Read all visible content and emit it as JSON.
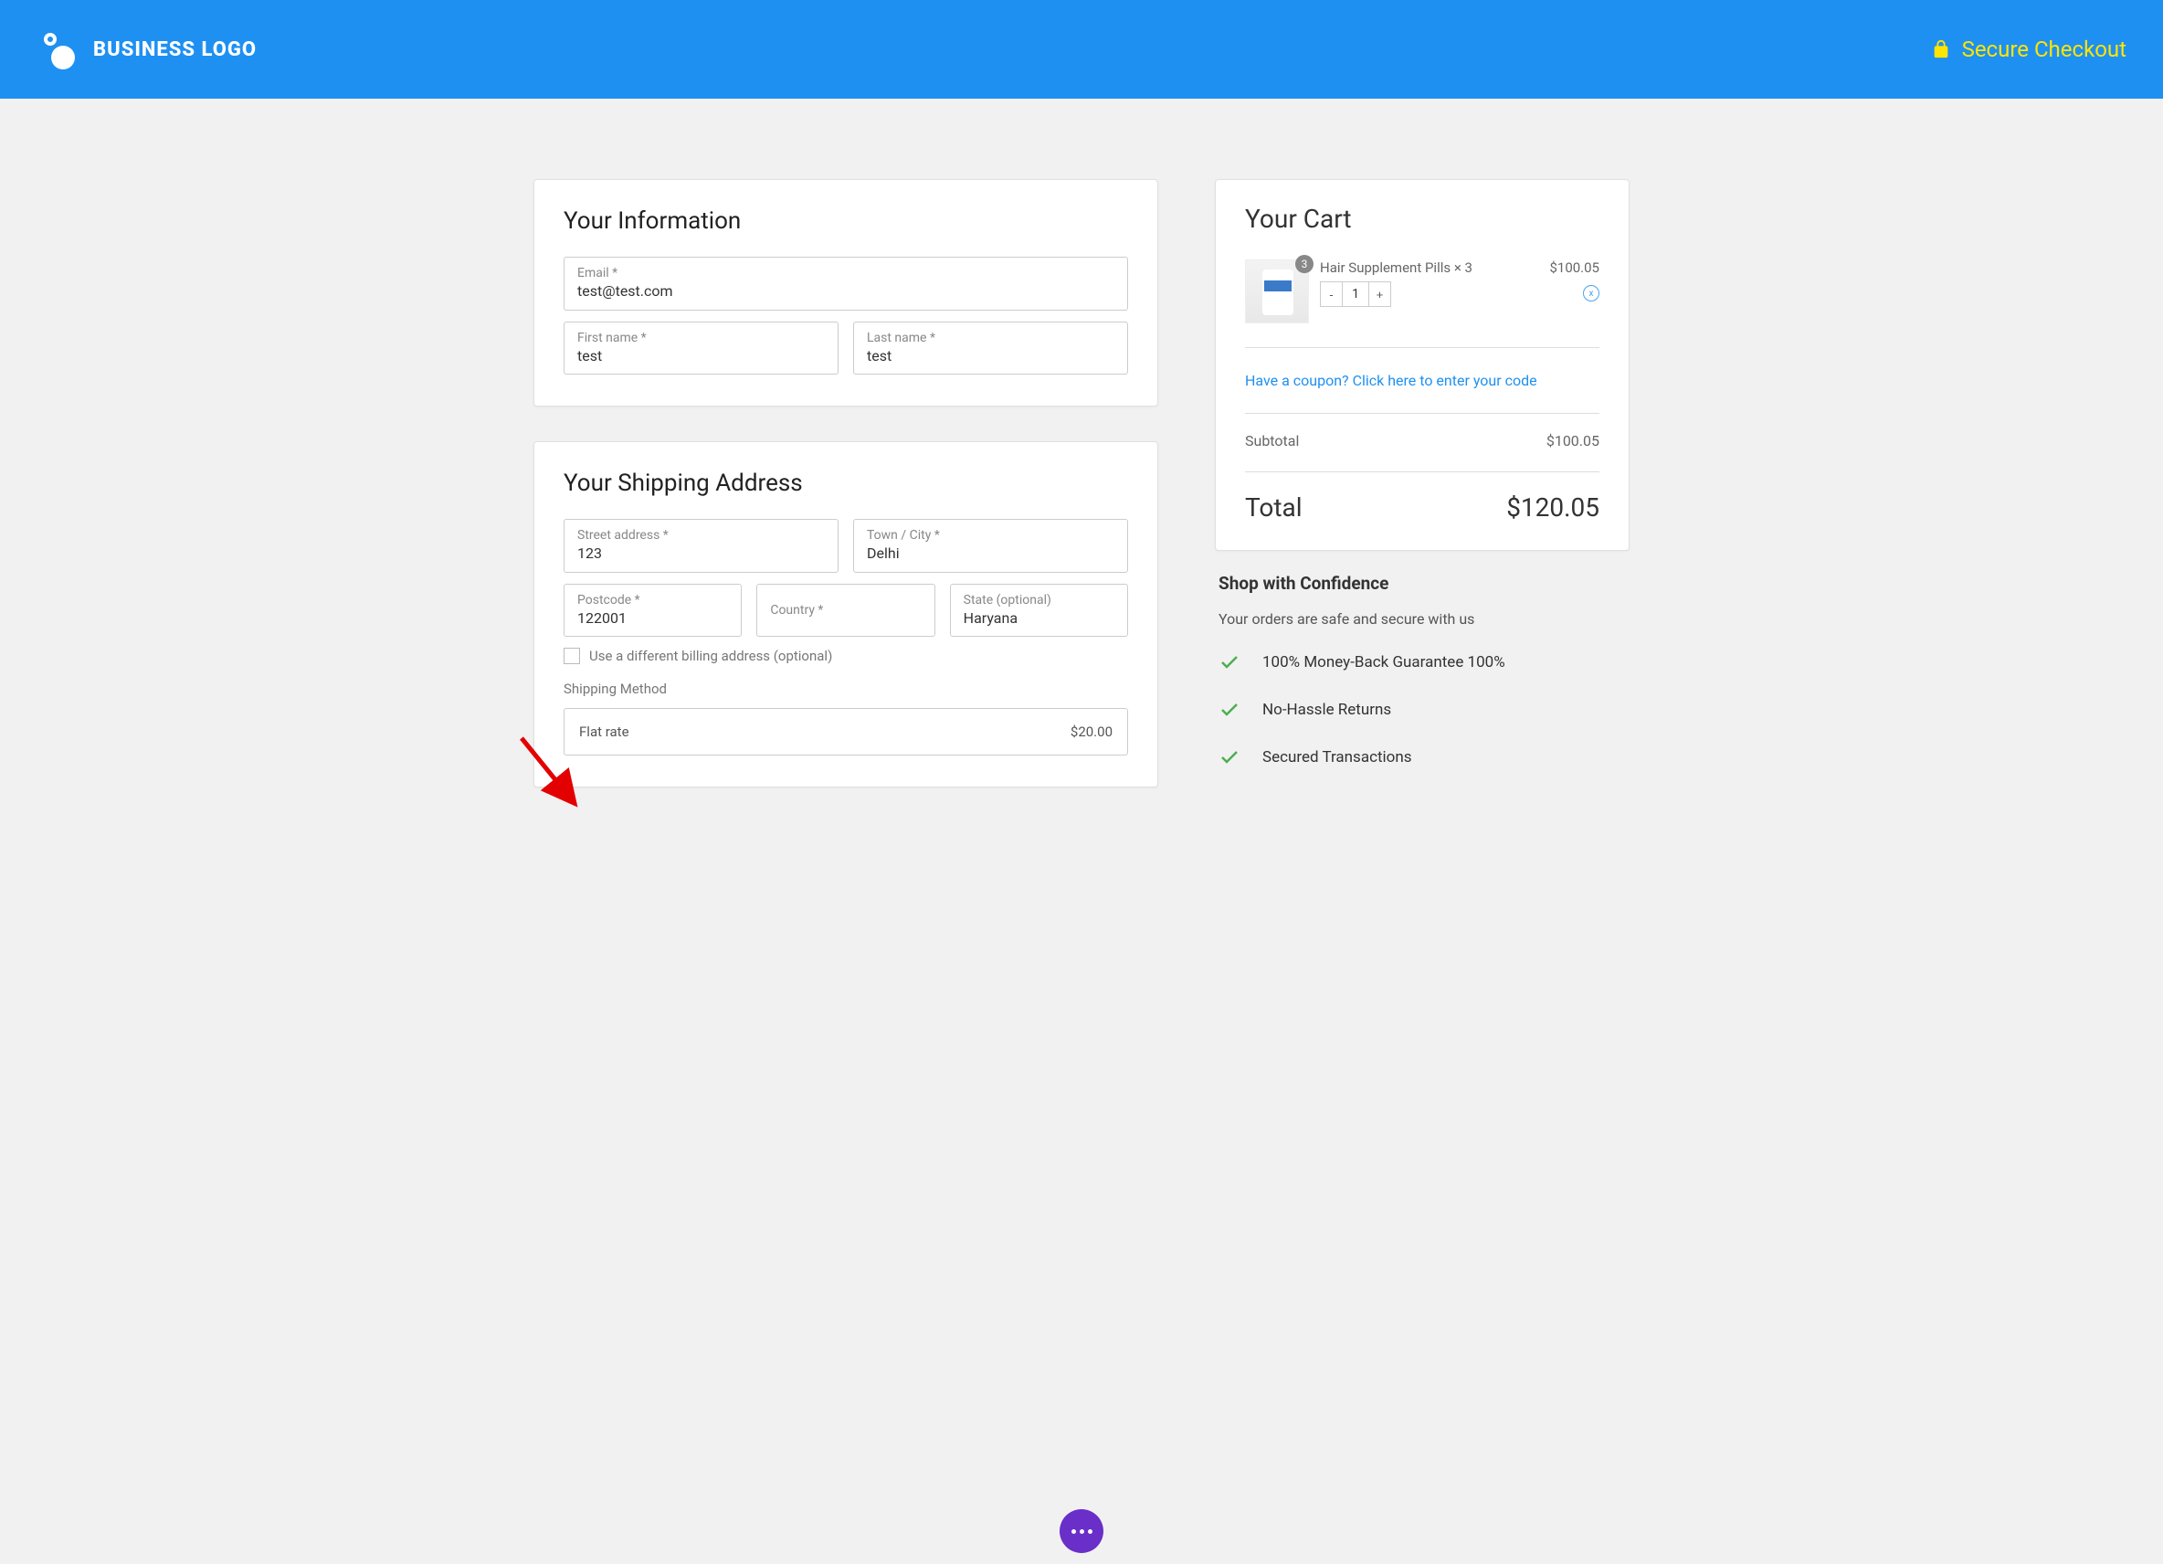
{
  "header": {
    "logo_text": "BUSINESS LOGO",
    "secure_text": "Secure Checkout"
  },
  "info": {
    "heading": "Your Information",
    "email_label": "Email *",
    "email_value": "test@test.com",
    "firstname_label": "First name *",
    "firstname_value": "test",
    "lastname_label": "Last name *",
    "lastname_value": "test"
  },
  "shipping": {
    "heading": "Your Shipping Address",
    "street_label": "Street address *",
    "street_value": "123",
    "city_label": "Town / City *",
    "city_value": "Delhi",
    "postcode_label": "Postcode *",
    "postcode_value": "122001",
    "country_label": "Country *",
    "country_value": "",
    "state_label": "State (optional)",
    "state_value": "Haryana",
    "billing_checkbox_label": "Use a different billing address (optional)",
    "method_heading": "Shipping Method",
    "flat_rate_label": "Flat rate",
    "flat_rate_price": "$20.00"
  },
  "cart": {
    "heading": "Your Cart",
    "item_name": "Hair Supplement Pills × 3",
    "item_qty_badge": "3",
    "item_qty_value": "1",
    "item_price": "$100.05",
    "remove_label": "x",
    "coupon_text": "Have a coupon? Click here to enter your code",
    "subtotal_label": "Subtotal",
    "subtotal_value": "$100.05",
    "total_label": "Total",
    "total_value": "$120.05"
  },
  "confidence": {
    "heading": "Shop with Confidence",
    "subtext": "Your orders are safe and secure with us",
    "items": [
      "100% Money-Back Guarantee 100%",
      "No-Hassle Returns",
      "Secured Transactions"
    ]
  }
}
